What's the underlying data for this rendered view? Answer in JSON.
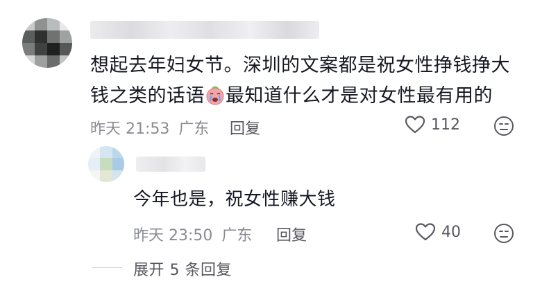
{
  "comment": {
    "text_line1": "想起去年妇女节。深圳的文案都是祝女性挣钱挣大",
    "text_line2a": "钱之类的话语",
    "emoji": "crying-face-emoji",
    "text_line2b": "最知道什么才是对女性最有用的",
    "time": "昨天 21:53",
    "location": "广东",
    "reply_label": "回复",
    "like_count": "112"
  },
  "reply": {
    "text": "今年也是，祝女性赚大钱",
    "time": "昨天 23:50",
    "location": "广东",
    "reply_label": "回复",
    "like_count": "40"
  },
  "expand_replies": "展开 5 条回复",
  "colors": {
    "text": "#161823",
    "meta": "#8a8b91",
    "action": "#57585f"
  }
}
